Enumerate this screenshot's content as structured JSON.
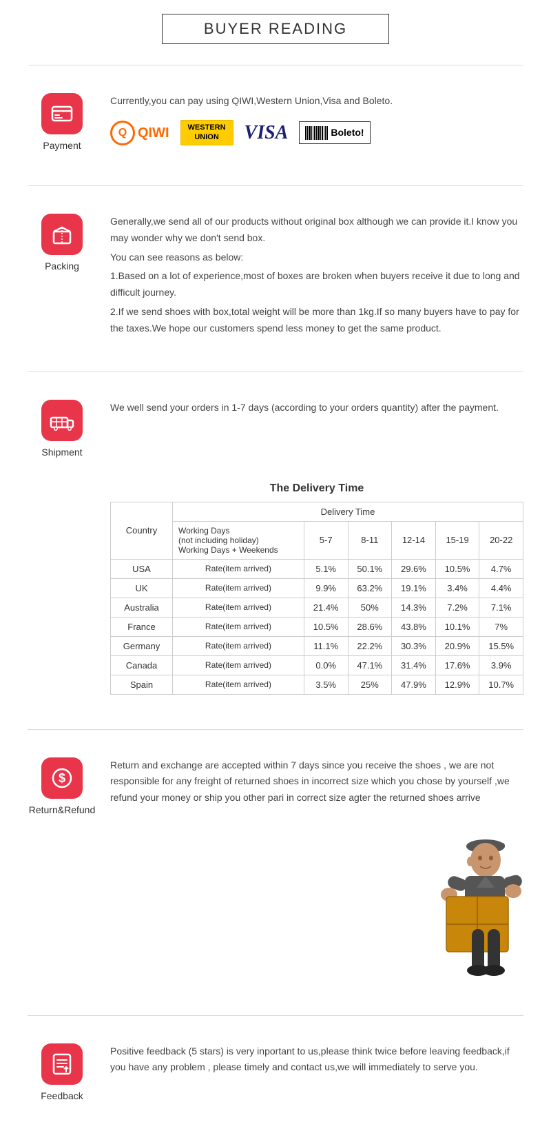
{
  "header": {
    "title": "BUYER READING"
  },
  "sections": {
    "payment": {
      "label": "Payment",
      "text": "Currently,you can pay using QIWI,Western Union,Visa and Boleto.",
      "logos": [
        "QIWI",
        "WESTERN UNION",
        "VISA",
        "Boleto"
      ]
    },
    "packing": {
      "label": "Packing",
      "paragraphs": [
        "Generally,we send all of our products without original box although we can provide it.I know you may wonder why we don't send box.",
        "You can see reasons as below:",
        "1.Based on a lot of experience,most of boxes are broken when buyers receive it due to long and difficult journey.",
        "2.If we send shoes with box,total weight will be more than 1kg.If so many buyers have to pay for the taxes.We hope our customers spend less money to get the same product."
      ]
    },
    "shipment": {
      "label": "Shipment",
      "intro": "We well send your orders in 1-7 days (according to your orders quantity) after the payment.",
      "tableTitle": "The Delivery Time",
      "tableHeaders": {
        "country": "Country",
        "deliveryTime": "Delivery Time",
        "subHeaders": {
          "workingDays": "Working Days\n(not including holiday)\nWorking Days + Weekends",
          "col1": "5-7",
          "col2": "8-11",
          "col3": "12-14",
          "col4": "15-19",
          "col5": "20-22"
        }
      },
      "tableRows": [
        {
          "country": "USA",
          "rate": "Rate(item arrived)",
          "v1": "5.1%",
          "v2": "50.1%",
          "v3": "29.6%",
          "v4": "10.5%",
          "v5": "4.7%"
        },
        {
          "country": "UK",
          "rate": "Rate(item arrived)",
          "v1": "9.9%",
          "v2": "63.2%",
          "v3": "19.1%",
          "v4": "3.4%",
          "v5": "4.4%"
        },
        {
          "country": "Australia",
          "rate": "Rate(item arrived)",
          "v1": "21.4%",
          "v2": "50%",
          "v3": "14.3%",
          "v4": "7.2%",
          "v5": "7.1%"
        },
        {
          "country": "France",
          "rate": "Rate(item arrived)",
          "v1": "10.5%",
          "v2": "28.6%",
          "v3": "43.8%",
          "v4": "10.1%",
          "v5": "7%"
        },
        {
          "country": "Germany",
          "rate": "Rate(item arrived)",
          "v1": "11.1%",
          "v2": "22.2%",
          "v3": "30.3%",
          "v4": "20.9%",
          "v5": "15.5%"
        },
        {
          "country": "Canada",
          "rate": "Rate(item arrived)",
          "v1": "0.0%",
          "v2": "47.1%",
          "v3": "31.4%",
          "v4": "17.6%",
          "v5": "3.9%"
        },
        {
          "country": "Spain",
          "rate": "Rate(item arrived)",
          "v1": "3.5%",
          "v2": "25%",
          "v3": "47.9%",
          "v4": "12.9%",
          "v5": "10.7%"
        }
      ]
    },
    "returnRefund": {
      "label": "Return&Refund",
      "text": "Return and exchange are accepted within 7 days since you receive the shoes , we are not responsible for any freight of returned shoes in incorrect size which you chose by yourself ,we refund your money or ship you other pari in correct size agter the returned shoes arrive"
    },
    "feedback": {
      "label": "Feedback",
      "text": "Positive feedback (5 stars) is very inportant to us,please think twice before leaving feedback,if you have any problem , please timely and contact us,we will immediately to serve you."
    }
  }
}
